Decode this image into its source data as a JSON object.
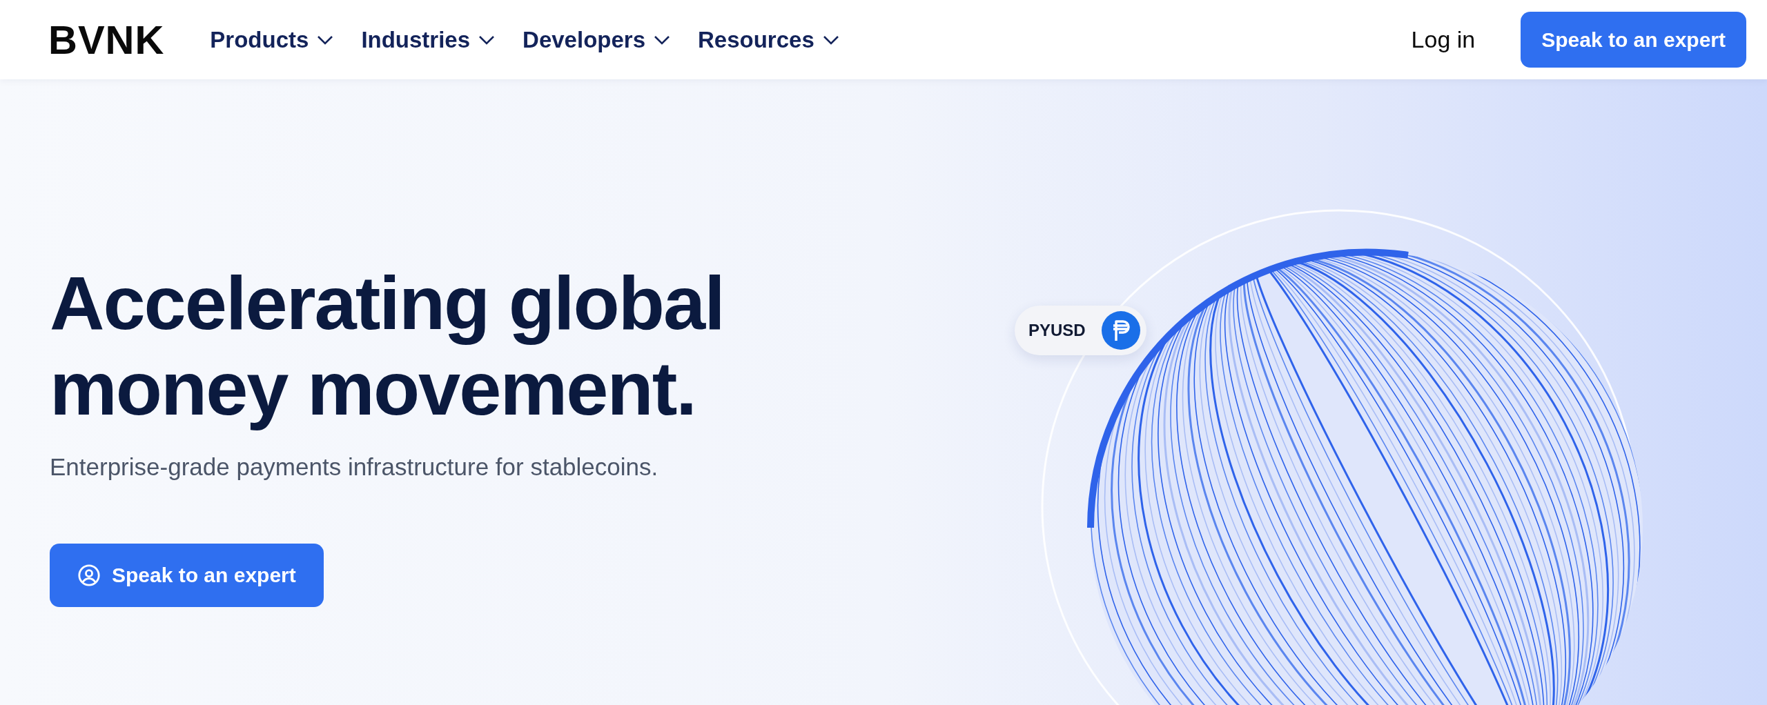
{
  "header": {
    "logo": "BVNK",
    "nav_items": [
      {
        "label": "Products"
      },
      {
        "label": "Industries"
      },
      {
        "label": "Developers"
      },
      {
        "label": "Resources"
      }
    ],
    "login": "Log in",
    "cta": "Speak to an expert"
  },
  "hero": {
    "title": "Accelerating global money movement.",
    "subtitle": "Enterprise-grade payments infrastructure for stablecoins.",
    "cta": "Speak to an expert",
    "token_badge": "PYUSD"
  }
}
